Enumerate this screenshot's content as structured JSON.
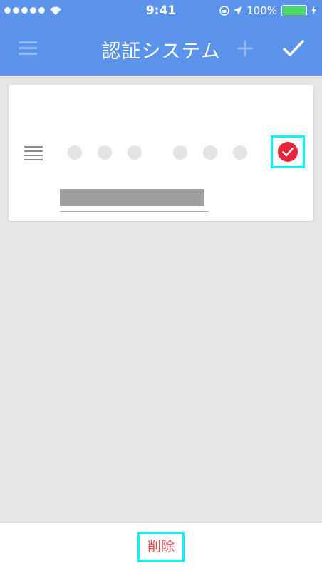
{
  "status_bar": {
    "time": "9:41",
    "battery_percent_label": "100%",
    "signal_icon": "signal-dots-icon",
    "wifi_icon": "wifi-icon",
    "location_icon": "location-arrow-icon",
    "lock_icon": "rotation-lock-icon",
    "charging_icon": "charging-bolt-icon"
  },
  "app_bar": {
    "title": "認証システム",
    "menu_icon": "menu-icon",
    "add_icon": "plus-icon",
    "confirm_icon": "checkmark-icon"
  },
  "account_card": {
    "drag_icon": "drag-handle-icon",
    "verify_icon": "check-circle-icon",
    "code_dot_count": 6
  },
  "footer": {
    "delete_label": "削除"
  },
  "colors": {
    "accent": "#5b93ea",
    "danger": "#e64b4b",
    "highlight": "#00f5ff",
    "background": "#e6e5e8"
  }
}
